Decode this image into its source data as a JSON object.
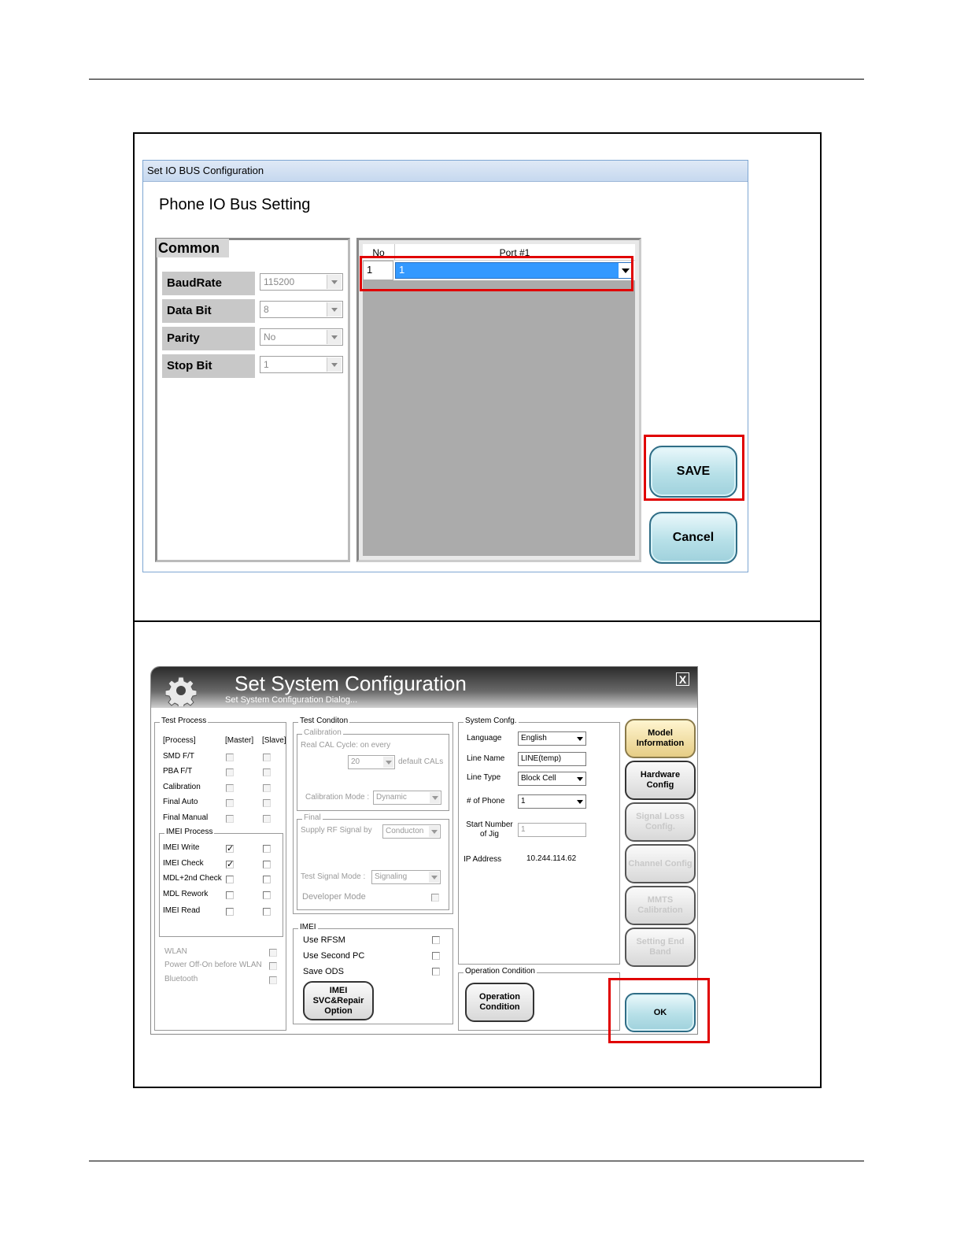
{
  "io_dialog": {
    "title": "Set IO BUS Configuration",
    "heading": "Phone IO Bus Setting",
    "common_group": "Common",
    "fields": [
      {
        "label": "BaudRate",
        "value": "115200"
      },
      {
        "label": "Data Bit",
        "value": "8"
      },
      {
        "label": "Parity",
        "value": "No"
      },
      {
        "label": "Stop Bit",
        "value": "1"
      }
    ],
    "grid": {
      "col_no": "No",
      "col_port": "Port #1",
      "row_no": "1",
      "row_port": "1"
    },
    "save_button": "SAVE",
    "cancel_button": "Cancel"
  },
  "sys_dialog": {
    "title": "Set System Configuration",
    "subtitle": "Set System Configuration Dialog...",
    "close_label": "X",
    "test_process": {
      "group": "Test Process",
      "col_process": "[Process]",
      "col_master": "[Master]",
      "col_slave": "[Slave]",
      "rows": [
        "SMD F/T",
        "PBA F/T",
        "Calibration",
        "Final Auto",
        "Final Manual"
      ],
      "imei_group": "IMEI Process",
      "imei_rows": [
        "IMEI Write",
        "IMEI Check",
        "MDL+2nd Check",
        "MDL Rework",
        "IMEI Read"
      ],
      "imei_master_checked": [
        true,
        true,
        false,
        false,
        false
      ],
      "wlan": "WLAN",
      "power_off_on": "Power Off-On before WLAN",
      "bluetooth": "Bluetooth"
    },
    "test_condition": {
      "group": "Test Conditon",
      "calibration_group": "Calibration",
      "real_cal": "Real CAL Cycle: on every",
      "cal_value": "20",
      "default_cals": "default CALs",
      "cal_mode_label": "Calibration Mode :",
      "cal_mode_value": "Dynamic",
      "final_group": "Final",
      "supply_rf": "Supply RF Signal by",
      "supply_value": "Conducton",
      "test_signal_label": "Test Signal Mode :",
      "test_signal_value": "Signaling",
      "developer_mode": "Developer Mode"
    },
    "imei": {
      "group": "IMEI",
      "use_rfsm": "Use RFSM",
      "use_second_pc": "Use Second PC",
      "save_ods": "Save ODS",
      "svc_button": "IMEI SVC&Repair Option"
    },
    "system_config": {
      "group": "System Confg.",
      "language_label": "Language",
      "language_value": "English",
      "line_name_label": "Line Name",
      "line_name_value": "LINE(temp)",
      "line_type_label": "Line Type",
      "line_type_value": "Block Cell",
      "num_phone_label": "# of Phone",
      "num_phone_value": "1",
      "start_number_label": "Start Number of Jig",
      "start_number_value": "1",
      "ip_label": "IP Address",
      "ip_value": "10.244.114.62"
    },
    "operation": {
      "group": "Operation Condition",
      "button": "Operation Condition"
    },
    "side_buttons": [
      {
        "label": "Model Information",
        "enabled": true
      },
      {
        "label": "Hardware Config",
        "enabled": true
      },
      {
        "label": "Signal Loss Config.",
        "enabled": false
      },
      {
        "label": "Channel Config",
        "enabled": false
      },
      {
        "label": "MMTS Calibration",
        "enabled": false
      },
      {
        "label": "Setting End Band",
        "enabled": false
      }
    ],
    "ok_button": "OK"
  }
}
